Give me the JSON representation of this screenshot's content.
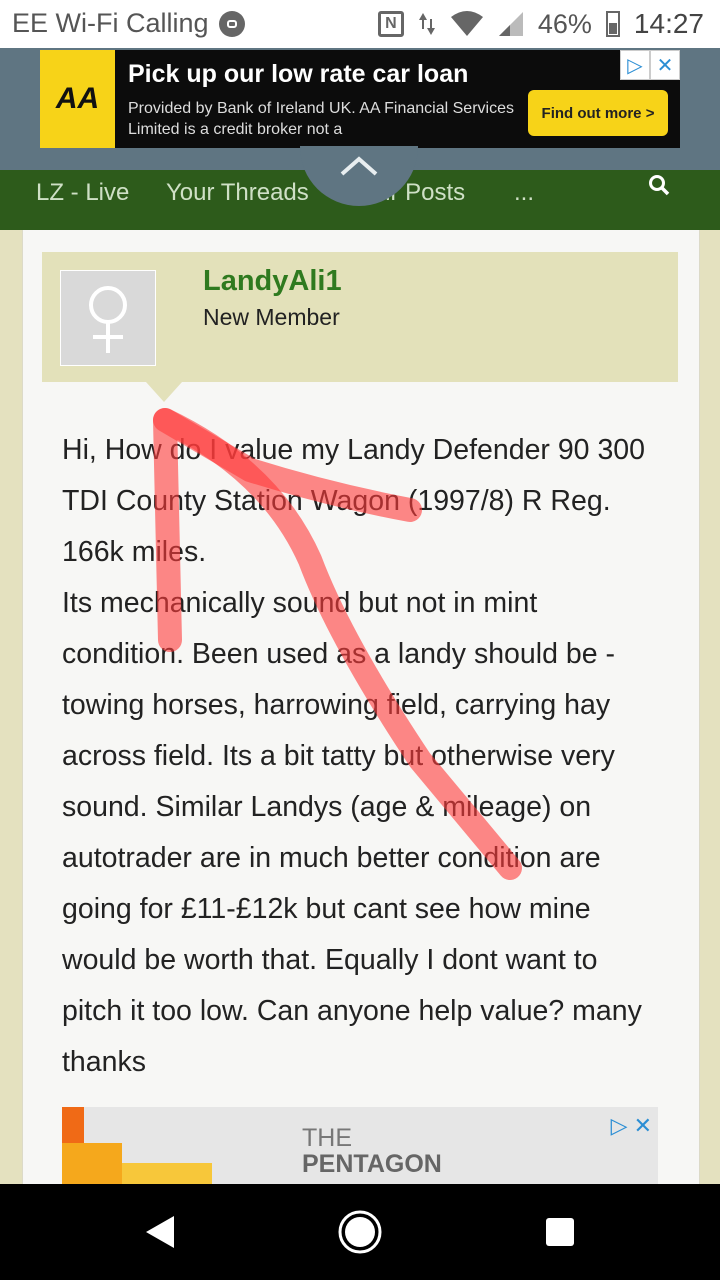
{
  "status_bar": {
    "carrier": "EE Wi-Fi Calling",
    "battery": "46%",
    "time": "14:27"
  },
  "ad_banner": {
    "logo": "AA",
    "headline": "Pick up our low rate car loan",
    "subtext": "Provided by Bank of Ireland UK. AA Financial Services Limited is a credit broker not a",
    "cta": "Find out more  >",
    "adchoices_icon": "adchoices-icon",
    "close_icon": "close-icon",
    "brand_color": "#f7d318"
  },
  "nav": {
    "items": [
      {
        "label": "LZ - Live"
      },
      {
        "label": "Your Threads"
      },
      {
        "label": "Your Posts"
      },
      {
        "label": "..."
      }
    ],
    "toggle_icon": "chevron-up-icon",
    "search_icon": "search-icon",
    "color": "#2d5b1b"
  },
  "post": {
    "username": "LandyAli1",
    "role": "New Member",
    "avatar_icon": "female-symbol-icon",
    "paragraphs": [
      "Hi, How do I value my Landy Defender 90 300 TDI County Station Wagon (1997/8) R Reg. 166k miles.",
      "Its mechanically sound but not in mint condition. Been used as a landy should be - towing horses, harrowing field, carrying hay across field. Its a bit tatty but otherwise very sound. Similar Landys (age & mileage) on autotrader are in much better condition are going for £11-£12k but cant see how mine would be worth that. Equally I dont want to pitch it too low. Can anyone help value? many thanks"
    ]
  },
  "bottom_ad": {
    "line1": "THE",
    "line2": "PENTAGON"
  },
  "android_nav": {
    "back_icon": "back-icon",
    "home_icon": "home-icon",
    "recents_icon": "recents-icon"
  }
}
